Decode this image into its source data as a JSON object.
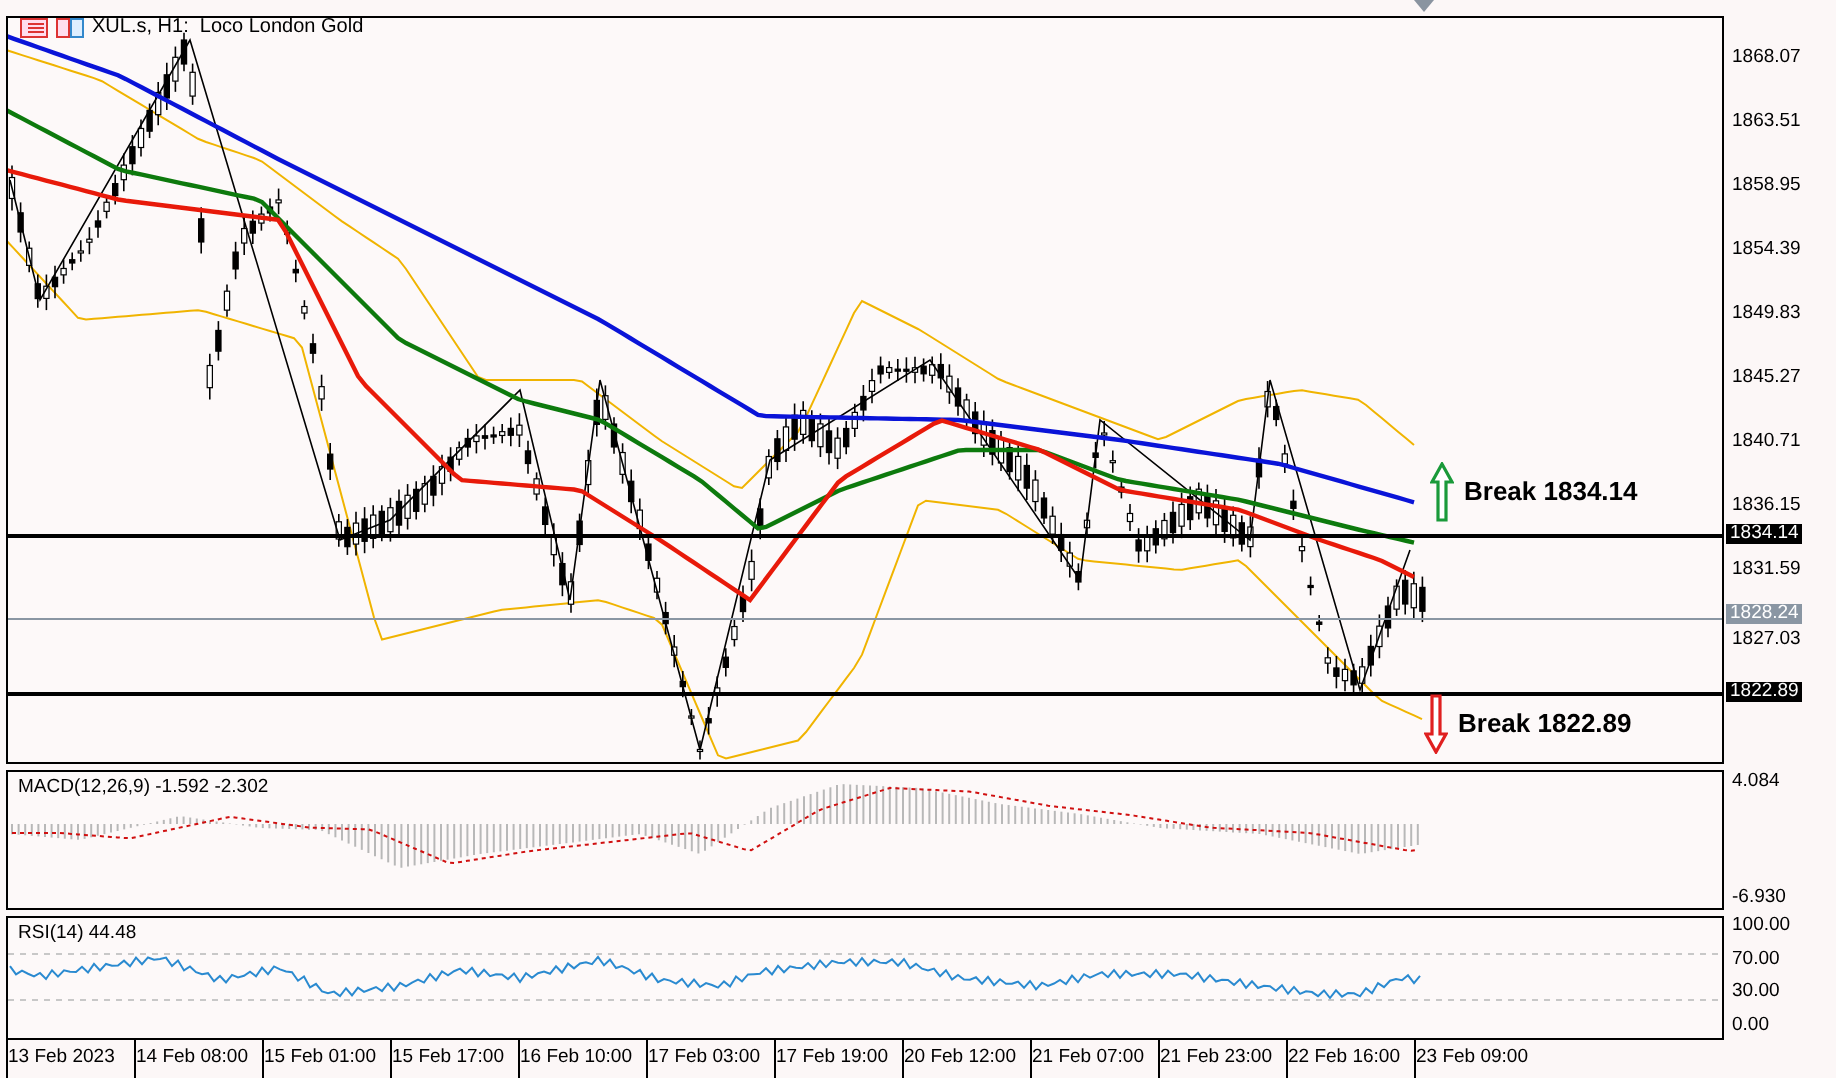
{
  "chart": {
    "title": "XUL.s, H1:  Loco London Gold",
    "price_axis": [
      "1868.07",
      "1863.51",
      "1858.95",
      "1854.39",
      "1849.83",
      "1845.27",
      "1840.71",
      "1836.15",
      "1831.59",
      "1827.03"
    ],
    "price_tags": [
      {
        "text": "1834.14",
        "kind": "level"
      },
      {
        "text": "1828.24",
        "kind": "bid"
      },
      {
        "text": "1822.89",
        "kind": "level"
      }
    ],
    "annotations": [
      {
        "text": "Break 1834.14",
        "kind": "up"
      },
      {
        "text": "Break 1822.89",
        "kind": "down"
      }
    ]
  },
  "macd": {
    "label": "MACD(12,26,9) -1.592 -2.302",
    "axis": [
      "4.084",
      "-6.930"
    ]
  },
  "rsi": {
    "label": "RSI(14) 44.48",
    "axis": [
      "100.00",
      "70.00",
      "30.00",
      "0.00"
    ]
  },
  "time_axis": [
    "13 Feb 2023",
    "14 Feb 08:00",
    "15 Feb 01:00",
    "15 Feb 17:00",
    "16 Feb 10:00",
    "17 Feb 03:00",
    "17 Feb 19:00",
    "20 Feb 12:00",
    "21 Feb 07:00",
    "21 Feb 23:00",
    "22 Feb 16:00",
    "23 Feb 09:00"
  ]
}
